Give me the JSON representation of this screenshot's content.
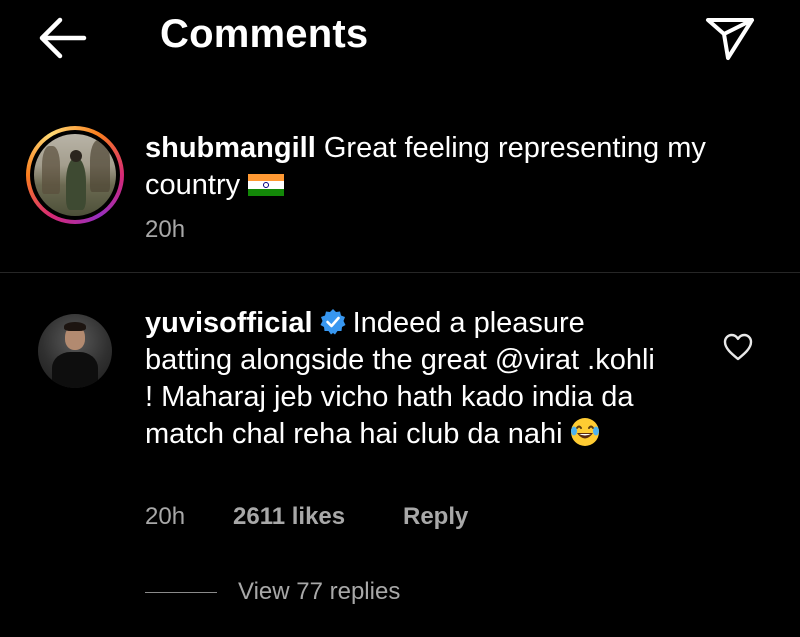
{
  "header": {
    "title": "Comments",
    "back_icon": "arrow-left-icon",
    "share_icon": "paper-plane-icon"
  },
  "caption": {
    "username": "shubmangill",
    "text": "Great feeling representing my country",
    "emoji": "india-flag",
    "time": "20h"
  },
  "comment": {
    "username": "yuvisofficial",
    "verified": true,
    "text_part1": "Indeed a pleasure batting alongside the great @virat .kohli ! Maharaj jeb vicho hath kado india da match chal reha hai club da nahi",
    "emoji": "face-with-tears-of-joy",
    "time": "20h",
    "likes": "2611 likes",
    "reply_label": "Reply",
    "view_replies": "View 77 replies",
    "heart_icon": "heart-outline-icon"
  },
  "colors": {
    "background": "#000000",
    "text_primary": "#ffffff",
    "text_secondary": "#a8a8a8",
    "verified_blue": "#3897f0",
    "divider": "#262626"
  }
}
